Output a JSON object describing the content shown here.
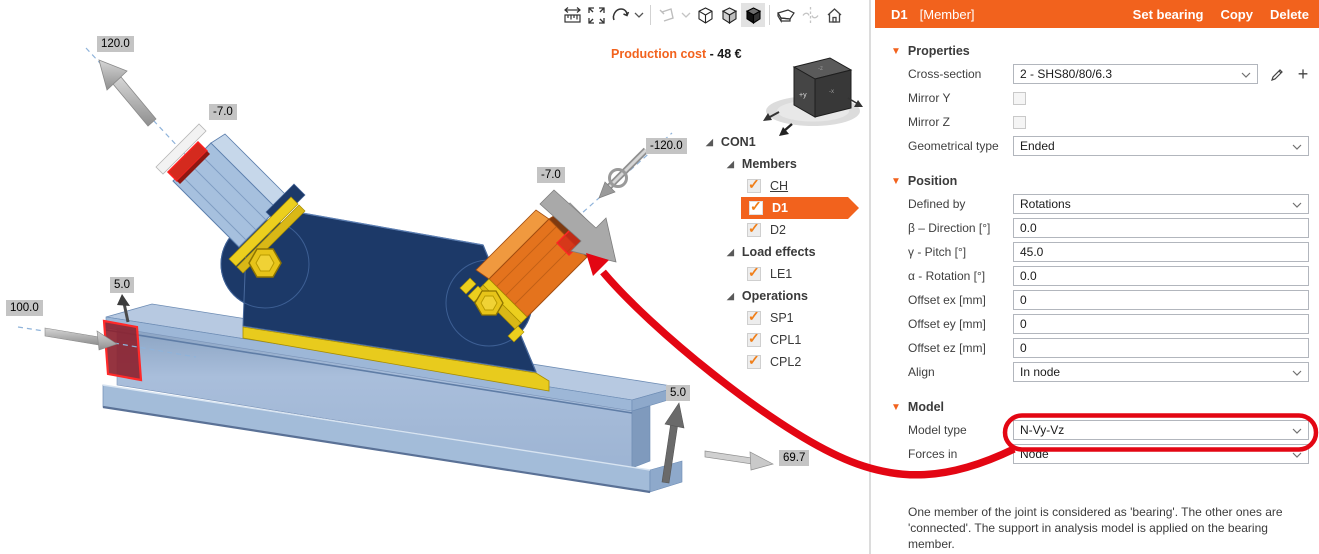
{
  "toolbar": {
    "icons": [
      "measure-icon",
      "zoom-extents-icon",
      "orbit-icon",
      "orbit-options-chevron",
      "section-plane-icon",
      "section-plane-options-chevron",
      "wireframe-view-icon",
      "shaded-view-icon",
      "solid-view-icon",
      "clipped-view-icon",
      "mirror-view-icon",
      "home-view-icon"
    ]
  },
  "production_cost": {
    "label": "Production cost",
    "separator": "-",
    "value": "48 €"
  },
  "viewport": {
    "load_labels": [
      "120.0",
      "-7.0",
      "-120.0",
      "-7.0",
      "5.0",
      "100.0",
      "5.0",
      "69.7"
    ]
  },
  "tree": {
    "root": "CON1",
    "groups": [
      {
        "label": "Members",
        "items": [
          {
            "label": "CH"
          },
          {
            "label": "D1"
          },
          {
            "label": "D2"
          }
        ]
      },
      {
        "label": "Load effects",
        "items": [
          {
            "label": "LE1"
          }
        ]
      },
      {
        "label": "Operations",
        "items": [
          {
            "label": "SP1"
          },
          {
            "label": "CPL1"
          },
          {
            "label": "CPL2"
          }
        ]
      }
    ]
  },
  "panel": {
    "title": "D1",
    "type_tag": "[Member]",
    "actions": {
      "set_bearing": "Set bearing",
      "copy": "Copy",
      "delete": "Delete"
    },
    "properties": {
      "title": "Properties",
      "cross_section_label": "Cross-section",
      "cross_section_value": "2 - SHS80/80/6.3",
      "mirror_y_label": "Mirror Y",
      "mirror_z_label": "Mirror Z",
      "geometrical_type_label": "Geometrical type",
      "geometrical_type_value": "Ended"
    },
    "position": {
      "title": "Position",
      "defined_by_label": "Defined by",
      "defined_by_value": "Rotations",
      "beta_label": "β – Direction [°]",
      "beta_value": "0.0",
      "gamma_label": "γ - Pitch [°]",
      "gamma_value": "45.0",
      "alpha_label": "α - Rotation [°]",
      "alpha_value": "0.0",
      "offset_ex_label": "Offset ex [mm]",
      "offset_ex_value": "0",
      "offset_ey_label": "Offset ey [mm]",
      "offset_ey_value": "0",
      "offset_ez_label": "Offset ez [mm]",
      "offset_ez_value": "0",
      "align_label": "Align",
      "align_value": "In node"
    },
    "model": {
      "title": "Model",
      "model_type_label": "Model type",
      "model_type_value": "N-Vy-Vz",
      "forces_in_label": "Forces in",
      "forces_in_value": "Node"
    },
    "help_text": "One member of the joint is considered as 'bearing'. The other ones are 'connected'. The support in analysis model is applied on the bearing member."
  },
  "colors": {
    "accent_orange": "#F2621D",
    "highlight_red": "#E30613",
    "label_gray": "#C4C4C4",
    "steel_blue": "#A6C0DE",
    "navy_plate": "#1C3968",
    "weld_yellow": "#ECCF1E",
    "member_orange": "#E4731D"
  }
}
